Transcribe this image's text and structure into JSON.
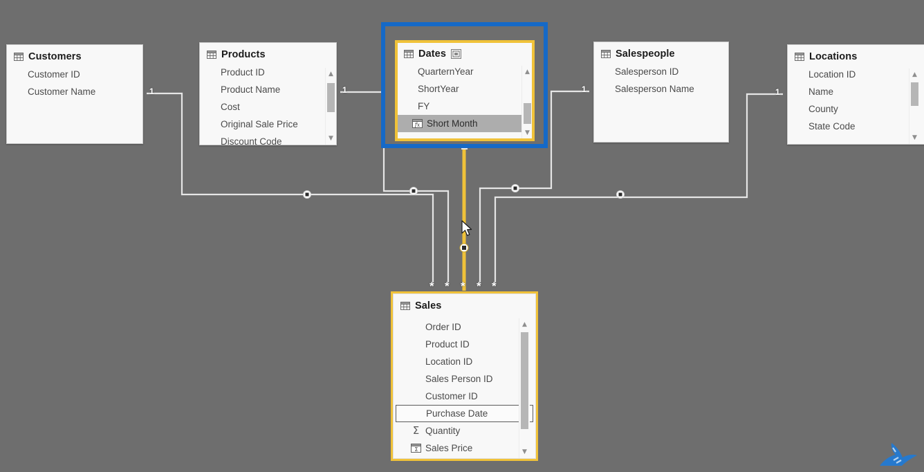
{
  "app": {
    "view_name": "Model view",
    "canvas_background": "#6e6e6e",
    "selection_color": "#1569c7",
    "highlight_color": "#f0c239",
    "card_background": "#f8f8f8",
    "line_color": "#e8e8e8"
  },
  "tables": [
    {
      "id": "customers",
      "name": "Customers",
      "icon": "table-grid-icon",
      "date_table_badge": false,
      "scrollbar": false,
      "fields": [
        {
          "name": "Customer ID",
          "icon": null,
          "state": "normal"
        },
        {
          "name": "Customer Name",
          "icon": null,
          "state": "normal"
        }
      ]
    },
    {
      "id": "products",
      "name": "Products",
      "icon": "table-grid-icon",
      "date_table_badge": false,
      "scrollbar": true,
      "fields": [
        {
          "name": "Product ID",
          "icon": null,
          "state": "normal"
        },
        {
          "name": "Product Name",
          "icon": null,
          "state": "normal"
        },
        {
          "name": "Cost",
          "icon": null,
          "state": "normal"
        },
        {
          "name": "Original Sale Price",
          "icon": null,
          "state": "normal"
        },
        {
          "name": "Discount Code",
          "icon": null,
          "state": "clipped"
        }
      ]
    },
    {
      "id": "dates",
      "name": "Dates",
      "icon": "table-grid-icon",
      "date_table_badge": true,
      "badge_icon": "mark-as-date-table-icon",
      "scrollbar": true,
      "selected": true,
      "fields": [
        {
          "name": "QuarternYear",
          "icon": null,
          "state": "normal"
        },
        {
          "name": "ShortYear",
          "icon": null,
          "state": "normal"
        },
        {
          "name": "FY",
          "icon": null,
          "state": "normal"
        },
        {
          "name": "Short Month",
          "icon": "calculated-column-icon",
          "state": "selected"
        }
      ]
    },
    {
      "id": "salespeople",
      "name": "Salespeople",
      "icon": "table-grid-icon",
      "date_table_badge": false,
      "scrollbar": false,
      "fields": [
        {
          "name": "Salesperson ID",
          "icon": null,
          "state": "normal"
        },
        {
          "name": "Salesperson Name",
          "icon": null,
          "state": "normal"
        }
      ]
    },
    {
      "id": "locations",
      "name": "Locations",
      "icon": "table-grid-icon",
      "date_table_badge": false,
      "scrollbar": true,
      "fields": [
        {
          "name": "Location ID",
          "icon": null,
          "state": "normal"
        },
        {
          "name": "Name",
          "icon": null,
          "state": "normal"
        },
        {
          "name": "County",
          "icon": null,
          "state": "normal"
        },
        {
          "name": "State Code",
          "icon": null,
          "state": "normal"
        }
      ]
    },
    {
      "id": "sales",
      "name": "Sales",
      "icon": "table-grid-icon",
      "date_table_badge": false,
      "scrollbar": true,
      "highlighted": true,
      "fields": [
        {
          "name": "Order ID",
          "icon": null,
          "state": "normal"
        },
        {
          "name": "Product ID",
          "icon": null,
          "state": "normal"
        },
        {
          "name": "Location ID",
          "icon": null,
          "state": "normal"
        },
        {
          "name": "Sales Person ID",
          "icon": null,
          "state": "normal"
        },
        {
          "name": "Customer ID",
          "icon": null,
          "state": "normal"
        },
        {
          "name": "Purchase Date",
          "icon": null,
          "state": "outlined"
        },
        {
          "name": "Quantity",
          "icon": "sigma-icon",
          "state": "normal"
        },
        {
          "name": "Sales Price",
          "icon": "calculated-column-icon",
          "state": "normal"
        }
      ]
    }
  ],
  "relationships": [
    {
      "id": "customers-sales",
      "from": "Customers",
      "to": "Sales",
      "from_cardinality": "1",
      "to_cardinality": "*",
      "highlighted": false
    },
    {
      "id": "products-sales",
      "from": "Products",
      "to": "Sales",
      "from_cardinality": "1",
      "to_cardinality": "*",
      "highlighted": false
    },
    {
      "id": "dates-sales",
      "from": "Dates",
      "to": "Sales",
      "from_cardinality": "1",
      "to_cardinality": "*",
      "highlighted": true
    },
    {
      "id": "salespeople-sales",
      "from": "Salespeople",
      "to": "Sales",
      "from_cardinality": "1",
      "to_cardinality": "*",
      "highlighted": false
    },
    {
      "id": "locations-sales",
      "from": "Locations",
      "to": "Sales",
      "from_cardinality": "1",
      "to_cardinality": "*",
      "highlighted": false
    }
  ],
  "cardinality_labels": {
    "one": "1",
    "many": "*"
  },
  "watermark": {
    "name": "whale-tail-logo",
    "color": "#1f7ad8"
  }
}
